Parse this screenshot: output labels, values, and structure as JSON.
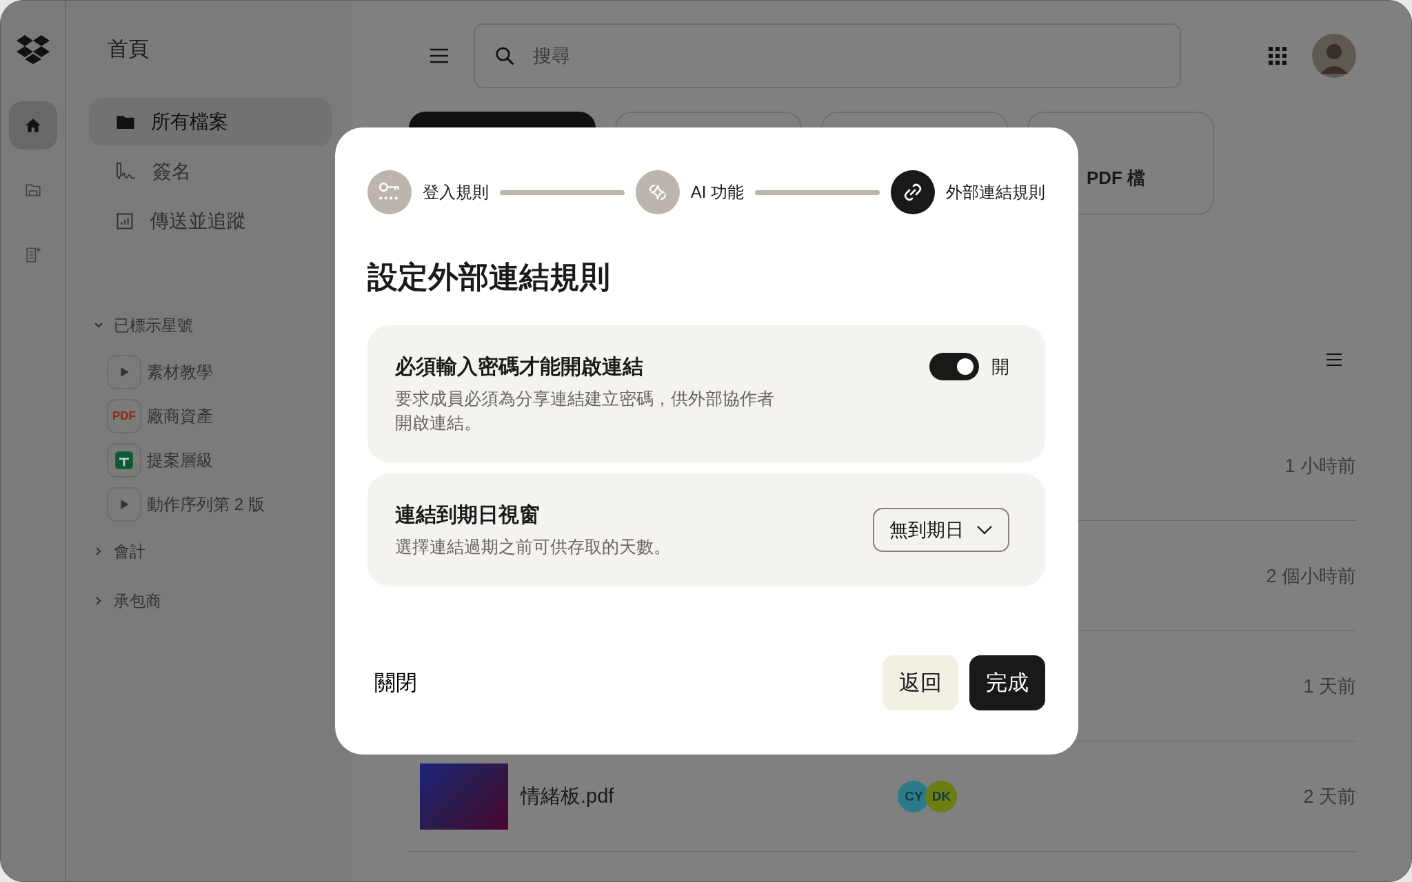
{
  "rail": {
    "items": [
      {
        "kind": "home",
        "selected": true
      },
      {
        "kind": "folder",
        "selected": false
      },
      {
        "kind": "doc",
        "selected": false
      }
    ]
  },
  "nav": {
    "title": "首頁",
    "items": [
      {
        "label": "所有檔案",
        "kind": "folder",
        "selected": true
      },
      {
        "label": "簽名",
        "kind": "sign",
        "selected": false
      },
      {
        "label": "傳送並追蹤",
        "kind": "chart",
        "selected": false
      }
    ],
    "sections": [
      {
        "label": "已標示星號",
        "expanded": true,
        "children": [
          {
            "label": "素材教學",
            "kind": "video"
          },
          {
            "label": "廠商資產",
            "kind": "pdf",
            "badge": "PDF"
          },
          {
            "label": "提案層級",
            "kind": "sheet"
          },
          {
            "label": "動作序列第 2 版",
            "kind": "video"
          }
        ]
      },
      {
        "label": "會計",
        "expanded": false
      },
      {
        "label": "承包商",
        "expanded": false
      }
    ]
  },
  "search": {
    "placeholder": "搜尋"
  },
  "quick_actions": [
    {
      "kind": "primary"
    },
    {
      "kind": "outline"
    },
    {
      "kind": "outline"
    },
    {
      "kind": "outline",
      "label": "PDF 檔"
    }
  ],
  "files": [
    {
      "time": "1 小時前"
    },
    {
      "time": "2 個小時前"
    },
    {
      "time": "1 天前"
    },
    {
      "name": "情緒板.pdf",
      "time": "2 天前",
      "avatars": [
        {
          "initials": "CY",
          "color": "#2b7a8a"
        },
        {
          "initials": "DK",
          "color": "#6c7d12"
        }
      ]
    }
  ],
  "dialog": {
    "steps": [
      {
        "label": "登入規則",
        "kind": "key",
        "current": false
      },
      {
        "label": "AI 功能",
        "kind": "ai",
        "current": false
      },
      {
        "label": "外部連結規則",
        "kind": "link",
        "current": true
      }
    ],
    "title": "設定外部連結規則",
    "settings": [
      {
        "kind": "toggle",
        "title": "必須輸入密碼才能開啟連結",
        "description": "要求成員必須為分享連結建立密碼，供外部協作者開啟連結。",
        "on": true,
        "state_label": "開"
      },
      {
        "kind": "dropdown",
        "title": "連結到期日視窗",
        "description": "選擇連結過期之前可供存取的天數。",
        "value": "無到期日"
      }
    ],
    "buttons": [
      {
        "label": "關閉",
        "kind": "text"
      },
      {
        "label": "返回",
        "kind": "secondary"
      },
      {
        "label": "完成",
        "kind": "primary"
      }
    ]
  }
}
